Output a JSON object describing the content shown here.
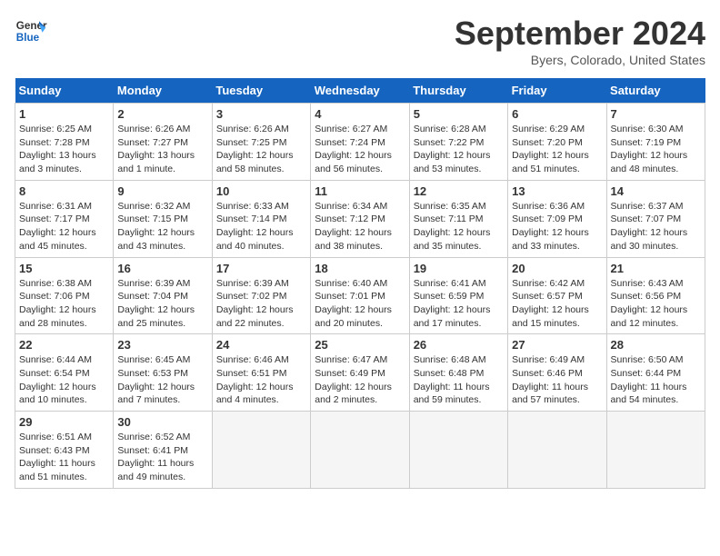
{
  "header": {
    "logo_line1": "General",
    "logo_line2": "Blue",
    "title": "September 2024",
    "subtitle": "Byers, Colorado, United States"
  },
  "days_of_week": [
    "Sunday",
    "Monday",
    "Tuesday",
    "Wednesday",
    "Thursday",
    "Friday",
    "Saturday"
  ],
  "weeks": [
    [
      {
        "day": "1",
        "info": "Sunrise: 6:25 AM\nSunset: 7:28 PM\nDaylight: 13 hours\nand 3 minutes."
      },
      {
        "day": "2",
        "info": "Sunrise: 6:26 AM\nSunset: 7:27 PM\nDaylight: 13 hours\nand 1 minute."
      },
      {
        "day": "3",
        "info": "Sunrise: 6:26 AM\nSunset: 7:25 PM\nDaylight: 12 hours\nand 58 minutes."
      },
      {
        "day": "4",
        "info": "Sunrise: 6:27 AM\nSunset: 7:24 PM\nDaylight: 12 hours\nand 56 minutes."
      },
      {
        "day": "5",
        "info": "Sunrise: 6:28 AM\nSunset: 7:22 PM\nDaylight: 12 hours\nand 53 minutes."
      },
      {
        "day": "6",
        "info": "Sunrise: 6:29 AM\nSunset: 7:20 PM\nDaylight: 12 hours\nand 51 minutes."
      },
      {
        "day": "7",
        "info": "Sunrise: 6:30 AM\nSunset: 7:19 PM\nDaylight: 12 hours\nand 48 minutes."
      }
    ],
    [
      {
        "day": "8",
        "info": "Sunrise: 6:31 AM\nSunset: 7:17 PM\nDaylight: 12 hours\nand 45 minutes."
      },
      {
        "day": "9",
        "info": "Sunrise: 6:32 AM\nSunset: 7:15 PM\nDaylight: 12 hours\nand 43 minutes."
      },
      {
        "day": "10",
        "info": "Sunrise: 6:33 AM\nSunset: 7:14 PM\nDaylight: 12 hours\nand 40 minutes."
      },
      {
        "day": "11",
        "info": "Sunrise: 6:34 AM\nSunset: 7:12 PM\nDaylight: 12 hours\nand 38 minutes."
      },
      {
        "day": "12",
        "info": "Sunrise: 6:35 AM\nSunset: 7:11 PM\nDaylight: 12 hours\nand 35 minutes."
      },
      {
        "day": "13",
        "info": "Sunrise: 6:36 AM\nSunset: 7:09 PM\nDaylight: 12 hours\nand 33 minutes."
      },
      {
        "day": "14",
        "info": "Sunrise: 6:37 AM\nSunset: 7:07 PM\nDaylight: 12 hours\nand 30 minutes."
      }
    ],
    [
      {
        "day": "15",
        "info": "Sunrise: 6:38 AM\nSunset: 7:06 PM\nDaylight: 12 hours\nand 28 minutes."
      },
      {
        "day": "16",
        "info": "Sunrise: 6:39 AM\nSunset: 7:04 PM\nDaylight: 12 hours\nand 25 minutes."
      },
      {
        "day": "17",
        "info": "Sunrise: 6:39 AM\nSunset: 7:02 PM\nDaylight: 12 hours\nand 22 minutes."
      },
      {
        "day": "18",
        "info": "Sunrise: 6:40 AM\nSunset: 7:01 PM\nDaylight: 12 hours\nand 20 minutes."
      },
      {
        "day": "19",
        "info": "Sunrise: 6:41 AM\nSunset: 6:59 PM\nDaylight: 12 hours\nand 17 minutes."
      },
      {
        "day": "20",
        "info": "Sunrise: 6:42 AM\nSunset: 6:57 PM\nDaylight: 12 hours\nand 15 minutes."
      },
      {
        "day": "21",
        "info": "Sunrise: 6:43 AM\nSunset: 6:56 PM\nDaylight: 12 hours\nand 12 minutes."
      }
    ],
    [
      {
        "day": "22",
        "info": "Sunrise: 6:44 AM\nSunset: 6:54 PM\nDaylight: 12 hours\nand 10 minutes."
      },
      {
        "day": "23",
        "info": "Sunrise: 6:45 AM\nSunset: 6:53 PM\nDaylight: 12 hours\nand 7 minutes."
      },
      {
        "day": "24",
        "info": "Sunrise: 6:46 AM\nSunset: 6:51 PM\nDaylight: 12 hours\nand 4 minutes."
      },
      {
        "day": "25",
        "info": "Sunrise: 6:47 AM\nSunset: 6:49 PM\nDaylight: 12 hours\nand 2 minutes."
      },
      {
        "day": "26",
        "info": "Sunrise: 6:48 AM\nSunset: 6:48 PM\nDaylight: 11 hours\nand 59 minutes."
      },
      {
        "day": "27",
        "info": "Sunrise: 6:49 AM\nSunset: 6:46 PM\nDaylight: 11 hours\nand 57 minutes."
      },
      {
        "day": "28",
        "info": "Sunrise: 6:50 AM\nSunset: 6:44 PM\nDaylight: 11 hours\nand 54 minutes."
      }
    ],
    [
      {
        "day": "29",
        "info": "Sunrise: 6:51 AM\nSunset: 6:43 PM\nDaylight: 11 hours\nand 51 minutes."
      },
      {
        "day": "30",
        "info": "Sunrise: 6:52 AM\nSunset: 6:41 PM\nDaylight: 11 hours\nand 49 minutes."
      },
      {
        "day": "",
        "info": ""
      },
      {
        "day": "",
        "info": ""
      },
      {
        "day": "",
        "info": ""
      },
      {
        "day": "",
        "info": ""
      },
      {
        "day": "",
        "info": ""
      }
    ]
  ]
}
